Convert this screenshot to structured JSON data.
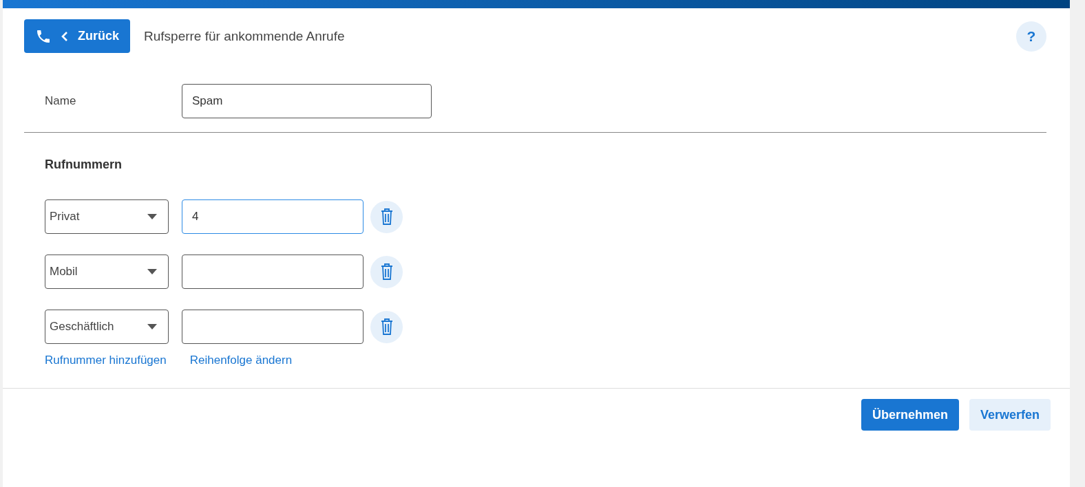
{
  "header": {
    "back_button": "Zurück",
    "title": "Rufsperre für ankommende Anrufe",
    "help_button": "?"
  },
  "name_field": {
    "label": "Name",
    "value": "Spam"
  },
  "numbers": {
    "heading": "Rufnummern",
    "rows": [
      {
        "type": "Privat",
        "value": "4",
        "focused": true
      },
      {
        "type": "Mobil",
        "focused": false
      },
      {
        "type": "Geschäftlich",
        "focused": false
      }
    ],
    "links": [
      "Rufnummer hinzufügen",
      "Reihenfolge ändern"
    ]
  },
  "footer": {
    "buttons": [
      {
        "label": "Übernehmen",
        "kind": "primary"
      },
      {
        "label": "Verwerfen",
        "kind": "secondary"
      }
    ]
  }
}
